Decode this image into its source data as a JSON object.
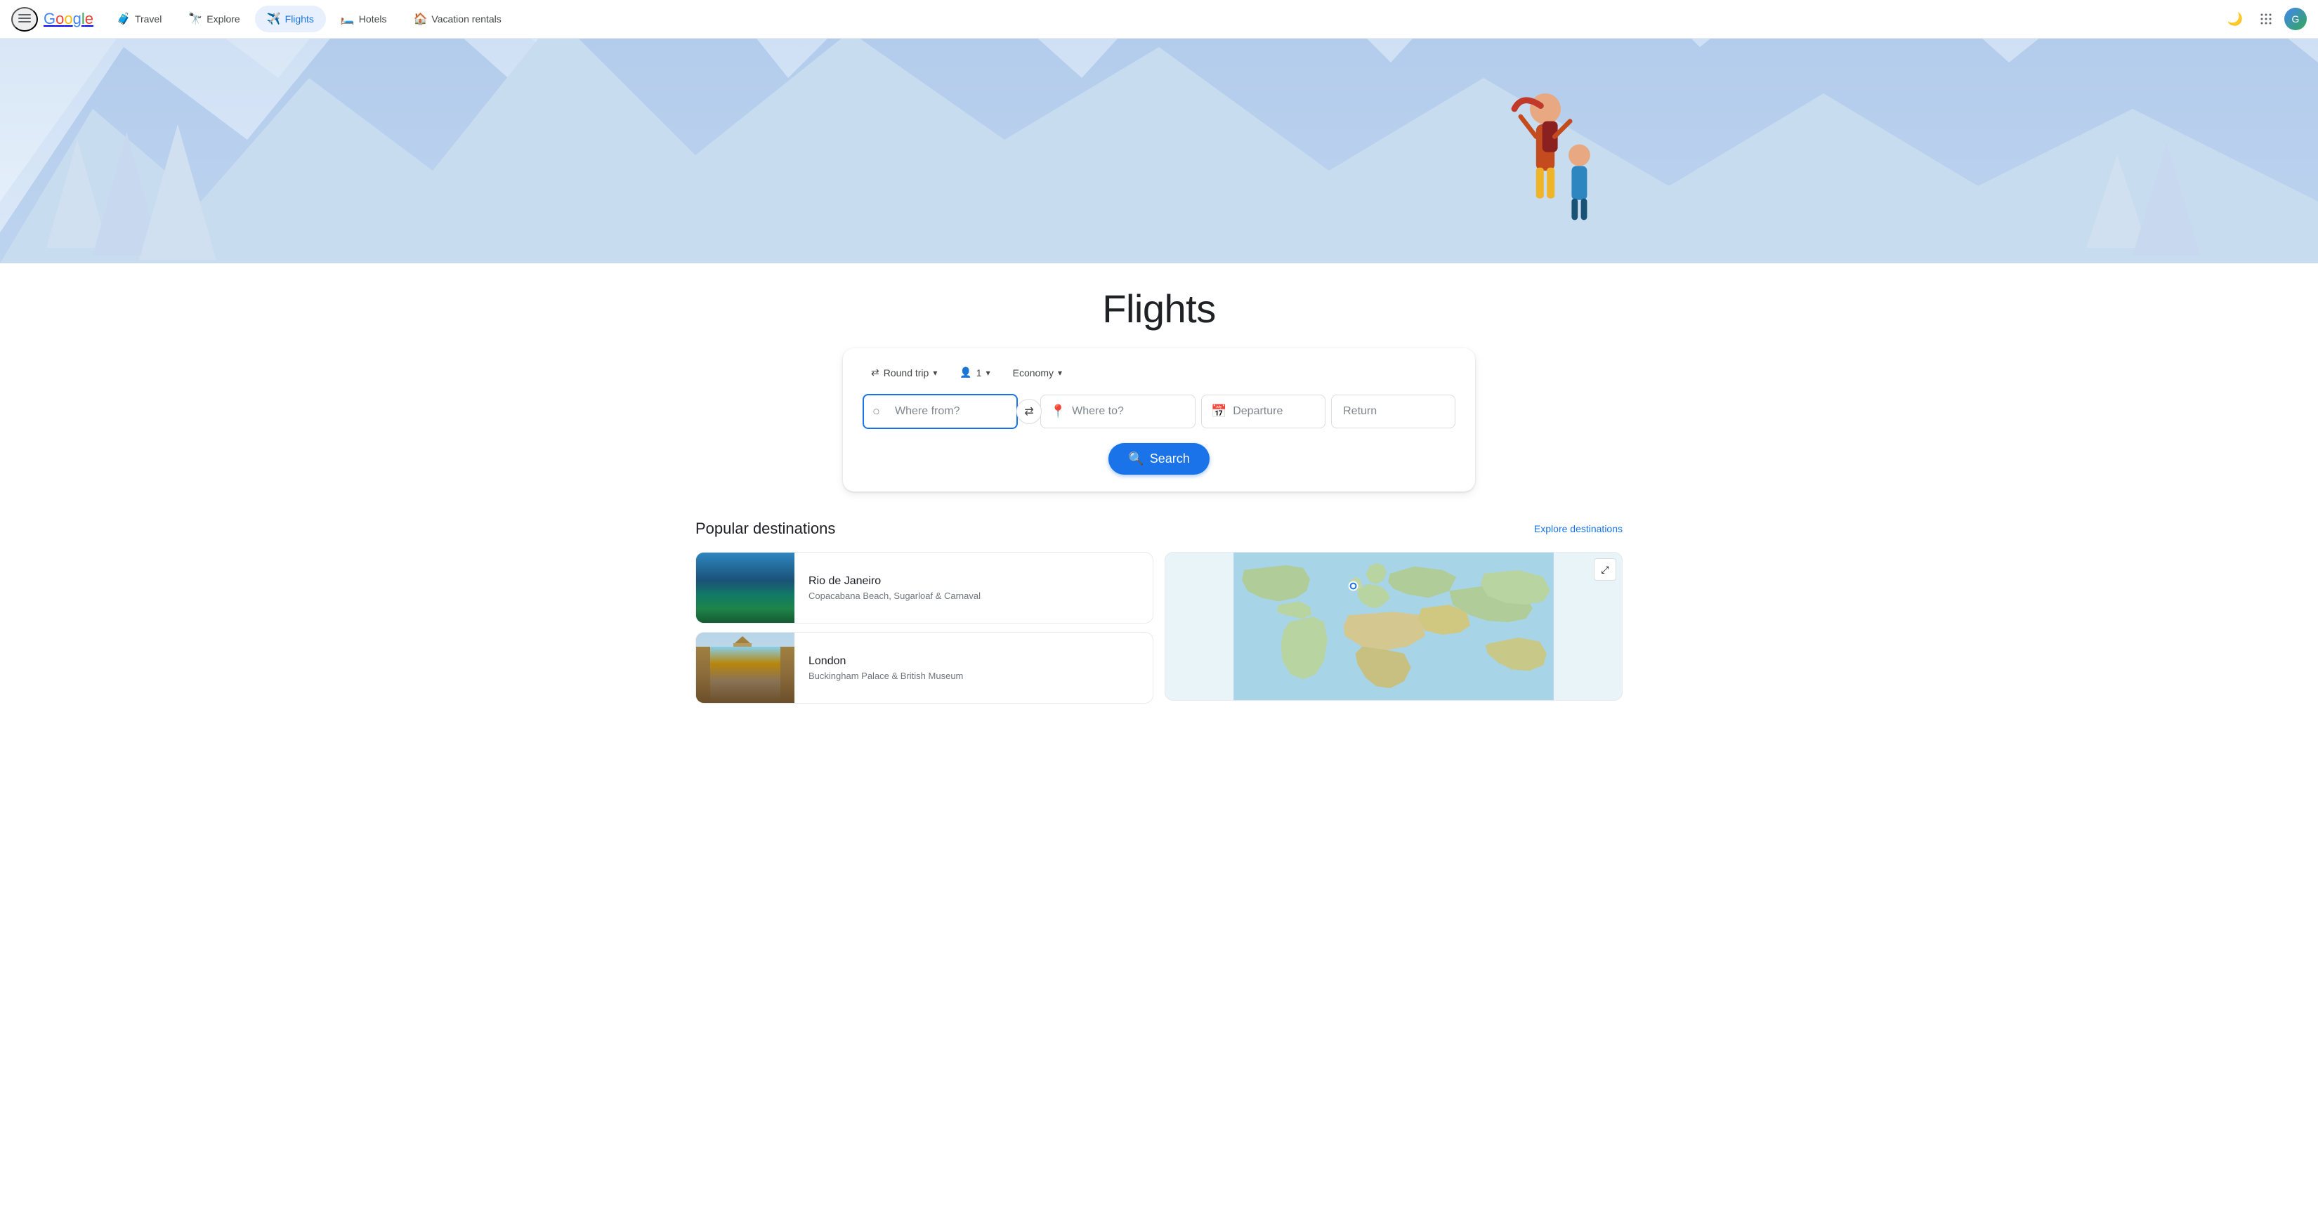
{
  "header": {
    "logo": "Google",
    "nav_tabs": [
      {
        "id": "travel",
        "label": "Travel",
        "icon": "🧳",
        "active": false
      },
      {
        "id": "explore",
        "label": "Explore",
        "icon": "🔭",
        "active": false
      },
      {
        "id": "flights",
        "label": "Flights",
        "icon": "✈️",
        "active": true
      },
      {
        "id": "hotels",
        "label": "Hotels",
        "icon": "🛏️",
        "active": false
      },
      {
        "id": "vacation",
        "label": "Vacation rentals",
        "icon": "🏠",
        "active": false
      }
    ],
    "menu_label": "Menu",
    "dark_mode_label": "Dark mode",
    "apps_label": "Google apps",
    "account_label": "Google Account"
  },
  "hero": {
    "title": "Flights",
    "airplane_icon": "✈"
  },
  "search": {
    "trip_type": {
      "label": "Round trip",
      "chevron": "▾"
    },
    "passengers": {
      "label": "1",
      "icon": "👤",
      "chevron": "▾"
    },
    "cabin_class": {
      "label": "Economy",
      "chevron": "▾"
    },
    "where_from_placeholder": "Where from?",
    "where_to_placeholder": "Where to?",
    "departure_placeholder": "Departure",
    "return_placeholder": "Return",
    "search_button_label": "Search",
    "swap_icon": "⇄"
  },
  "popular": {
    "section_title": "Popular destinations",
    "explore_link": "Explore destinations",
    "destinations": [
      {
        "id": "rio",
        "name": "Rio de Janeiro",
        "description": "Copacabana Beach, Sugarloaf & Carnaval"
      },
      {
        "id": "london",
        "name": "London",
        "description": "Buckingham Palace & British Museum"
      }
    ]
  }
}
